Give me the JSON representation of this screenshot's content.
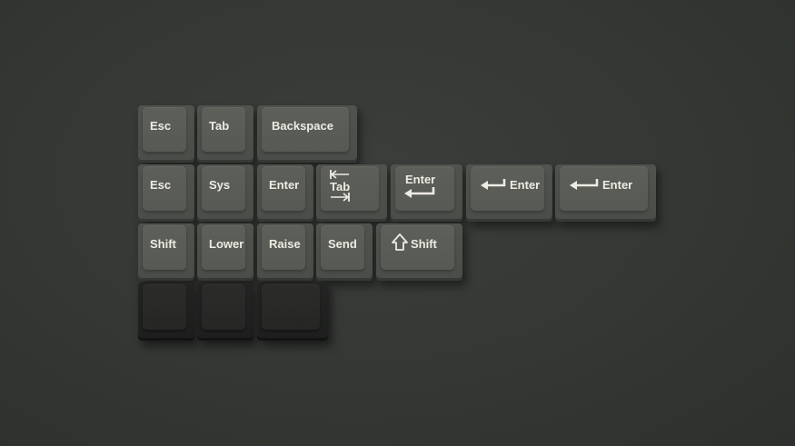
{
  "keys": {
    "row1": [
      "Esc",
      "Tab",
      "Backspace"
    ],
    "row2": [
      "Esc",
      "Sys",
      "Enter",
      "Tab",
      "Enter",
      "Enter",
      "Enter"
    ],
    "row3": [
      "Shift",
      "Lower",
      "Raise",
      "Send",
      "Shift"
    ]
  },
  "colors": {
    "background": "#353834",
    "keycap": "#575a54",
    "legend": "#ecebe4",
    "blank_keycap": "#262725"
  },
  "icons": {
    "tab_arrows": "tab-arrows-icon",
    "enter_arrow": "enter-arrow-icon",
    "shift_arrow": "shift-arrow-icon"
  }
}
